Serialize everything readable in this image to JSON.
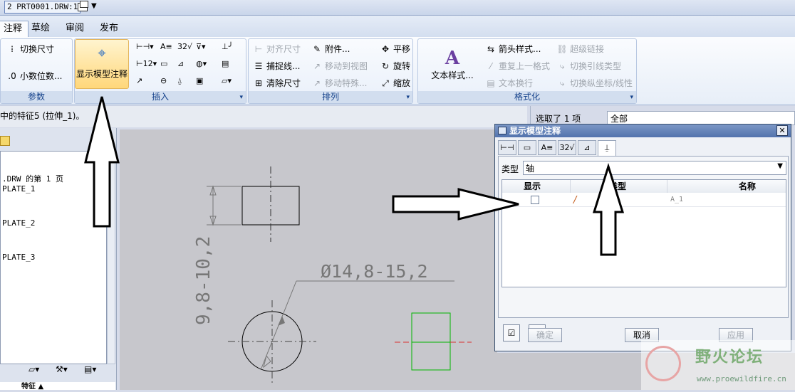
{
  "window": {
    "doc_tab": "2 PRT0001.DRW:1",
    "caret": "▼"
  },
  "tabs": [
    "注释",
    "草绘",
    "审阅",
    "发布"
  ],
  "ribbon": {
    "params": {
      "switch_dims": "切换尺寸",
      "decimals": "小数位数...",
      "label": "参数"
    },
    "show_model": "显示模型注释",
    "insert": {
      "label": "插入"
    },
    "arrange": {
      "label": "排列",
      "align": "对齐尺寸",
      "capture": "捕捉线...",
      "clean": "清除尺寸",
      "attach": "附件...",
      "move_view": "移动到视图",
      "move_special": "移动特殊...",
      "pan": "平移",
      "rotate": "旋转",
      "zoom": "缩放"
    },
    "format": {
      "label": "格式化",
      "text_style": "文本样式...",
      "arrow_style": "箭头样式...",
      "repeat_format": "重复上一格式",
      "text_wrap": "文本换行",
      "hyperlink": "超级链接",
      "toggle_leader": "切换引线类型",
      "toggle_ordinate": "切换纵坐标/线性"
    }
  },
  "status": {
    "message": "中的特征5 (拉伸_1)。",
    "selected": "选取了 1 项",
    "filter": "全部"
  },
  "tree": {
    "items": [
      ".DRW 的第 1 页",
      "PLATE_1",
      "PLATE_2",
      "PLATE_3"
    ],
    "bottom_label": "特征 ▲"
  },
  "drawing": {
    "dim_vertical": "9,8-10,2",
    "dim_diameter": "Ø14,8-15,2"
  },
  "dialog": {
    "title": "显示模型注释",
    "type_label": "类型",
    "type_value": "轴",
    "col_show": "显示",
    "col_type": "类型",
    "col_name": "名称",
    "row_name": "A_1",
    "btn_ok": "确定",
    "btn_cancel": "取消",
    "btn_apply": "应用"
  },
  "watermark": {
    "text": "野火论坛",
    "url": "www.proewildfire.cn"
  },
  "colors": {
    "accent": "#5273ad",
    "highlight": "#ffd77a",
    "green_rect": "#00b400",
    "red_center": "#d83030"
  }
}
